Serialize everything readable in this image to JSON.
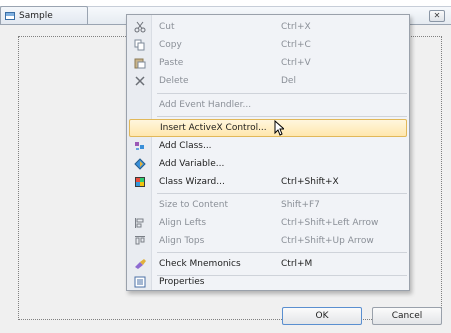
{
  "dialog": {
    "title": "Sample",
    "close_symbol": "✕",
    "ok_label": "OK",
    "cancel_label": "Cancel"
  },
  "menu": {
    "items": [
      {
        "label": "Cut",
        "shortcut": "Ctrl+X",
        "icon": "cut-icon",
        "enabled": false
      },
      {
        "label": "Copy",
        "shortcut": "Ctrl+C",
        "icon": "copy-icon",
        "enabled": false
      },
      {
        "label": "Paste",
        "shortcut": "Ctrl+V",
        "icon": "paste-icon",
        "enabled": false
      },
      {
        "label": "Delete",
        "shortcut": "Del",
        "icon": "delete-icon",
        "enabled": false
      },
      {
        "label": "Add Event Handler...",
        "shortcut": "",
        "icon": "",
        "enabled": false
      },
      {
        "label": "Insert ActiveX Control...",
        "shortcut": "",
        "icon": "",
        "enabled": true
      },
      {
        "label": "Add Class...",
        "shortcut": "",
        "icon": "add-class-icon",
        "enabled": true
      },
      {
        "label": "Add Variable...",
        "shortcut": "",
        "icon": "add-variable-icon",
        "enabled": true
      },
      {
        "label": "Class Wizard...",
        "shortcut": "Ctrl+Shift+X",
        "icon": "class-wizard-icon",
        "enabled": true
      },
      {
        "label": "Size to Content",
        "shortcut": "Shift+F7",
        "icon": "",
        "enabled": false
      },
      {
        "label": "Align Lefts",
        "shortcut": "Ctrl+Shift+Left Arrow",
        "icon": "align-lefts-icon",
        "enabled": false
      },
      {
        "label": "Align Tops",
        "shortcut": "Ctrl+Shift+Up Arrow",
        "icon": "align-tops-icon",
        "enabled": false
      },
      {
        "label": "Check Mnemonics",
        "shortcut": "Ctrl+M",
        "icon": "check-mnemonics-icon",
        "enabled": true
      },
      {
        "label": "Properties",
        "shortcut": "",
        "icon": "properties-icon",
        "enabled": true
      }
    ]
  },
  "colors": {
    "highlight_top": "#fff6dd",
    "highlight_bottom": "#ffe7ad",
    "highlight_border": "#e1b85a",
    "disabled_text": "#8a8f97"
  }
}
